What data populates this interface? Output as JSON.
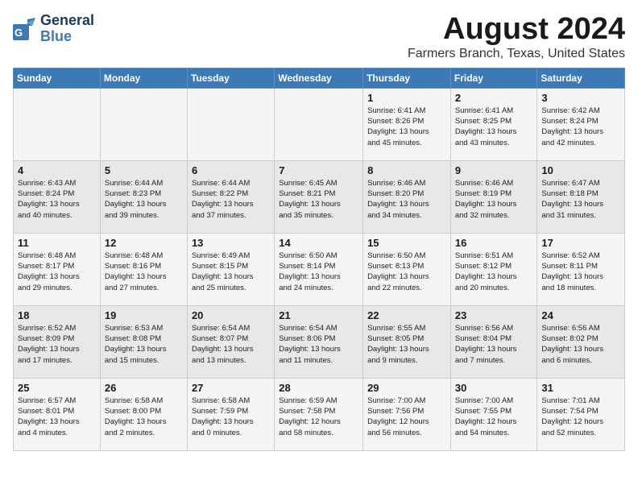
{
  "header": {
    "logo_line1": "General",
    "logo_line2": "Blue",
    "month_title": "August 2024",
    "location": "Farmers Branch, Texas, United States"
  },
  "weekdays": [
    "Sunday",
    "Monday",
    "Tuesday",
    "Wednesday",
    "Thursday",
    "Friday",
    "Saturday"
  ],
  "weeks": [
    [
      {
        "day": "",
        "info": ""
      },
      {
        "day": "",
        "info": ""
      },
      {
        "day": "",
        "info": ""
      },
      {
        "day": "",
        "info": ""
      },
      {
        "day": "1",
        "info": "Sunrise: 6:41 AM\nSunset: 8:26 PM\nDaylight: 13 hours\nand 45 minutes."
      },
      {
        "day": "2",
        "info": "Sunrise: 6:41 AM\nSunset: 8:25 PM\nDaylight: 13 hours\nand 43 minutes."
      },
      {
        "day": "3",
        "info": "Sunrise: 6:42 AM\nSunset: 8:24 PM\nDaylight: 13 hours\nand 42 minutes."
      }
    ],
    [
      {
        "day": "4",
        "info": "Sunrise: 6:43 AM\nSunset: 8:24 PM\nDaylight: 13 hours\nand 40 minutes."
      },
      {
        "day": "5",
        "info": "Sunrise: 6:44 AM\nSunset: 8:23 PM\nDaylight: 13 hours\nand 39 minutes."
      },
      {
        "day": "6",
        "info": "Sunrise: 6:44 AM\nSunset: 8:22 PM\nDaylight: 13 hours\nand 37 minutes."
      },
      {
        "day": "7",
        "info": "Sunrise: 6:45 AM\nSunset: 8:21 PM\nDaylight: 13 hours\nand 35 minutes."
      },
      {
        "day": "8",
        "info": "Sunrise: 6:46 AM\nSunset: 8:20 PM\nDaylight: 13 hours\nand 34 minutes."
      },
      {
        "day": "9",
        "info": "Sunrise: 6:46 AM\nSunset: 8:19 PM\nDaylight: 13 hours\nand 32 minutes."
      },
      {
        "day": "10",
        "info": "Sunrise: 6:47 AM\nSunset: 8:18 PM\nDaylight: 13 hours\nand 31 minutes."
      }
    ],
    [
      {
        "day": "11",
        "info": "Sunrise: 6:48 AM\nSunset: 8:17 PM\nDaylight: 13 hours\nand 29 minutes."
      },
      {
        "day": "12",
        "info": "Sunrise: 6:48 AM\nSunset: 8:16 PM\nDaylight: 13 hours\nand 27 minutes."
      },
      {
        "day": "13",
        "info": "Sunrise: 6:49 AM\nSunset: 8:15 PM\nDaylight: 13 hours\nand 25 minutes."
      },
      {
        "day": "14",
        "info": "Sunrise: 6:50 AM\nSunset: 8:14 PM\nDaylight: 13 hours\nand 24 minutes."
      },
      {
        "day": "15",
        "info": "Sunrise: 6:50 AM\nSunset: 8:13 PM\nDaylight: 13 hours\nand 22 minutes."
      },
      {
        "day": "16",
        "info": "Sunrise: 6:51 AM\nSunset: 8:12 PM\nDaylight: 13 hours\nand 20 minutes."
      },
      {
        "day": "17",
        "info": "Sunrise: 6:52 AM\nSunset: 8:11 PM\nDaylight: 13 hours\nand 18 minutes."
      }
    ],
    [
      {
        "day": "18",
        "info": "Sunrise: 6:52 AM\nSunset: 8:09 PM\nDaylight: 13 hours\nand 17 minutes."
      },
      {
        "day": "19",
        "info": "Sunrise: 6:53 AM\nSunset: 8:08 PM\nDaylight: 13 hours\nand 15 minutes."
      },
      {
        "day": "20",
        "info": "Sunrise: 6:54 AM\nSunset: 8:07 PM\nDaylight: 13 hours\nand 13 minutes."
      },
      {
        "day": "21",
        "info": "Sunrise: 6:54 AM\nSunset: 8:06 PM\nDaylight: 13 hours\nand 11 minutes."
      },
      {
        "day": "22",
        "info": "Sunrise: 6:55 AM\nSunset: 8:05 PM\nDaylight: 13 hours\nand 9 minutes."
      },
      {
        "day": "23",
        "info": "Sunrise: 6:56 AM\nSunset: 8:04 PM\nDaylight: 13 hours\nand 7 minutes."
      },
      {
        "day": "24",
        "info": "Sunrise: 6:56 AM\nSunset: 8:02 PM\nDaylight: 13 hours\nand 6 minutes."
      }
    ],
    [
      {
        "day": "25",
        "info": "Sunrise: 6:57 AM\nSunset: 8:01 PM\nDaylight: 13 hours\nand 4 minutes."
      },
      {
        "day": "26",
        "info": "Sunrise: 6:58 AM\nSunset: 8:00 PM\nDaylight: 13 hours\nand 2 minutes."
      },
      {
        "day": "27",
        "info": "Sunrise: 6:58 AM\nSunset: 7:59 PM\nDaylight: 13 hours\nand 0 minutes."
      },
      {
        "day": "28",
        "info": "Sunrise: 6:59 AM\nSunset: 7:58 PM\nDaylight: 12 hours\nand 58 minutes."
      },
      {
        "day": "29",
        "info": "Sunrise: 7:00 AM\nSunset: 7:56 PM\nDaylight: 12 hours\nand 56 minutes."
      },
      {
        "day": "30",
        "info": "Sunrise: 7:00 AM\nSunset: 7:55 PM\nDaylight: 12 hours\nand 54 minutes."
      },
      {
        "day": "31",
        "info": "Sunrise: 7:01 AM\nSunset: 7:54 PM\nDaylight: 12 hours\nand 52 minutes."
      }
    ]
  ]
}
